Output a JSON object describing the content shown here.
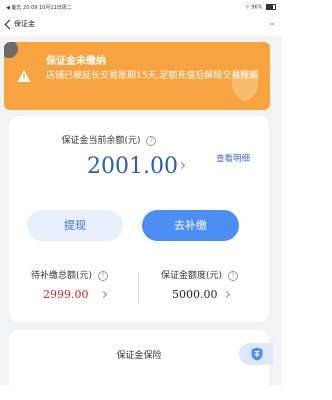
{
  "status_bar": {
    "left_text": "◀ 备忘  20:09  10月11日周二",
    "right_text": "⌔ 96%"
  },
  "nav": {
    "title": "保证金",
    "more": "···"
  },
  "notice": {
    "title": "保证金未缴纳",
    "body": "店铺已被延长交易账期15天,足额充值后解除交易账期"
  },
  "balance": {
    "label": "保证金当前余额(元)",
    "help": "?",
    "value": "2001.00",
    "detail_link": "查看明细"
  },
  "actions": {
    "withdraw": "提现",
    "topup": "去补缴"
  },
  "stats": {
    "pending": {
      "label": "待补缴总额(元)",
      "value": "2999.00"
    },
    "quota": {
      "label": "保证金额度(元)",
      "value": "5000.00"
    }
  },
  "insurance": {
    "title": "保证金保险"
  },
  "colors": {
    "notice_bg": "#f7a440",
    "accent": "#4d8ef5",
    "balance_text": "#2f5fa8",
    "pending_text": "#c8242b"
  }
}
